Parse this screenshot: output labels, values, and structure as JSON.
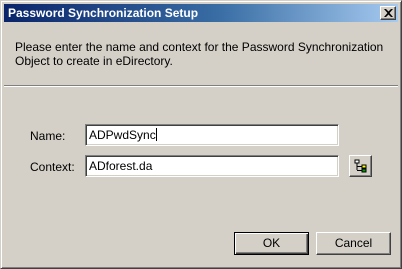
{
  "window": {
    "title": "Password Synchronization Setup",
    "close_icon": "close-icon"
  },
  "description": "Please enter the name and context for the Password Synchronization Object to create in eDirectory.",
  "form": {
    "name_label": "Name:",
    "name_value": "ADPwdSync",
    "context_label": "Context:",
    "context_value": "ADforest.da",
    "browse_icon": "tree-browse-icon"
  },
  "buttons": {
    "ok_label": "OK",
    "cancel_label": "Cancel"
  },
  "colors": {
    "titlebar_start": "#0a246a",
    "titlebar_end": "#a6caf0",
    "dialog_bg": "#d4d0c8"
  }
}
